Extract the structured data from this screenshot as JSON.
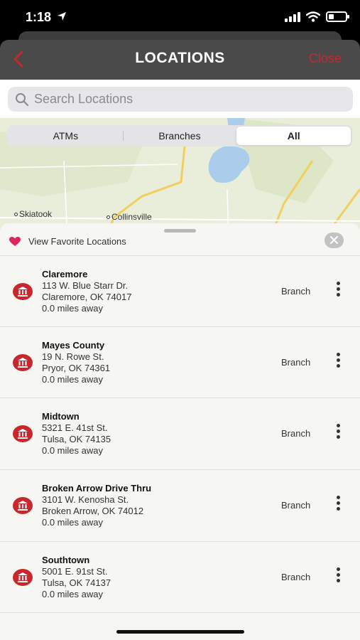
{
  "status": {
    "time": "1:18",
    "battery_level": 0.3
  },
  "nav": {
    "title": "LOCATIONS",
    "close_label": "Close"
  },
  "search": {
    "placeholder": "Search Locations"
  },
  "segments": [
    {
      "label": "ATMs",
      "active": false
    },
    {
      "label": "Branches",
      "active": false
    },
    {
      "label": "All",
      "active": true
    }
  ],
  "map": {
    "labels": {
      "skiatook": "Skiatook",
      "collinsville": "Collinsville"
    }
  },
  "favorites": {
    "label": "View Favorite Locations"
  },
  "locations": [
    {
      "name": "Claremore",
      "address": "113 W. Blue Starr Dr.",
      "city": "Claremore, OK 74017",
      "distance": "0.0 miles away",
      "type": "Branch"
    },
    {
      "name": "Mayes County",
      "address": "19 N. Rowe St.",
      "city": "Pryor, OK 74361",
      "distance": "0.0 miles away",
      "type": "Branch"
    },
    {
      "name": "Midtown",
      "address": "5321 E. 41st St.",
      "city": "Tulsa, OK 74135",
      "distance": "0.0 miles away",
      "type": "Branch"
    },
    {
      "name": "Broken Arrow Drive Thru",
      "address": "3101 W. Kenosha St.",
      "city": "Broken Arrow, OK 74012",
      "distance": "0.0 miles away",
      "type": "Branch"
    },
    {
      "name": "Southtown",
      "address": "5001 E. 91st St.",
      "city": "Tulsa, OK 74137",
      "distance": "0.0 miles away",
      "type": "Branch"
    }
  ],
  "colors": {
    "accent": "#c7282d",
    "nav_bg": "#4a4a4a",
    "panel_bg": "#f6f6f3",
    "heart": "#e0245e"
  }
}
